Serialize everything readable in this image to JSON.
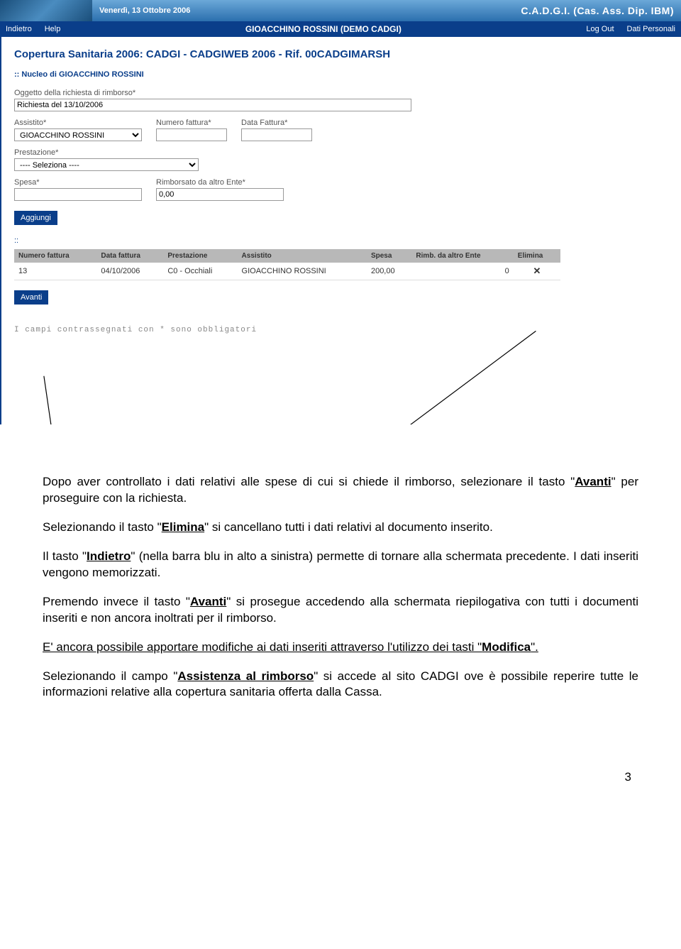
{
  "banner": {
    "date": "Venerdì, 13 Ottobre 2006",
    "title": "C.A.D.G.I. (Cas. Ass. Dip. IBM)"
  },
  "nav": {
    "back": "Indietro",
    "help": "Help",
    "center": "GIOACCHINO ROSSINI (DEMO CADGI)",
    "logout": "Log Out",
    "personal": "Dati Personali"
  },
  "page": {
    "title": "Copertura Sanitaria 2006: CADGI - CADGIWEB 2006 - Rif. 00CADGIMARSH",
    "nucleo": "Nucleo di GIOACCHINO ROSSINI"
  },
  "form": {
    "oggetto_label": "Oggetto della richiesta di rimborso*",
    "oggetto_value": "Richiesta del 13/10/2006",
    "assistito_label": "Assistito*",
    "assistito_value": "GIOACCHINO ROSSINI",
    "numfatt_label": "Numero fattura*",
    "numfatt_value": "",
    "datafatt_label": "Data Fattura*",
    "datafatt_value": "",
    "prestazione_label": "Prestazione*",
    "prestazione_value": "---- Seleziona ----",
    "spesa_label": "Spesa*",
    "spesa_value": "",
    "rimb_label": "Rimborsato da altro Ente*",
    "rimb_value": "0,00",
    "aggiungi": "Aggiungi",
    "avanti": "Avanti"
  },
  "table": {
    "headers": [
      "Numero fattura",
      "Data fattura",
      "Prestazione",
      "Assistito",
      "Spesa",
      "Rimb. da altro Ente",
      "Elimina"
    ],
    "row": {
      "num": "13",
      "data": "04/10/2006",
      "prest": "C0 - Occhiali",
      "ass": "GIOACCHINO ROSSINI",
      "spesa": "200,00",
      "rimb": "0",
      "del": "✕"
    }
  },
  "footnote": "I campi contrassegnati con * sono obbligatori",
  "doc": {
    "p1a": "Dopo aver controllato i dati relativi alle spese di cui si chiede il rimborso, selezionare il tasto \"",
    "p1b": "Avanti",
    "p1c": "\" per proseguire con la richiesta.",
    "p2a": "Selezionando il tasto \"",
    "p2b": "Elimina",
    "p2c": "\" si cancellano tutti i dati relativi al documento inserito.",
    "p3a": "Il tasto \"",
    "p3b": "Indietro",
    "p3c": "\" (nella barra blu in alto a sinistra) permette di tornare alla schermata precedente. I dati inseriti vengono memorizzati.",
    "p4a": "Premendo invece il tasto \"",
    "p4b": "Avanti",
    "p4c": "\" si prosegue accedendo alla schermata riepilogativa con tutti i documenti inseriti e non ancora inoltrati per il rimborso.",
    "p5a": "E' ancora possibile apportare modifiche ai dati inseriti attraverso l'utilizzo dei tasti \"",
    "p5b": "Modifica",
    "p5c": "\".",
    "p6a": "Selezionando il campo \"",
    "p6b": "Assistenza al rimborso",
    "p6c": "\" si accede al sito CADGI ove è possibile reperire tutte le informazioni relative alla copertura sanitaria offerta dalla Cassa."
  },
  "page_number": "3"
}
